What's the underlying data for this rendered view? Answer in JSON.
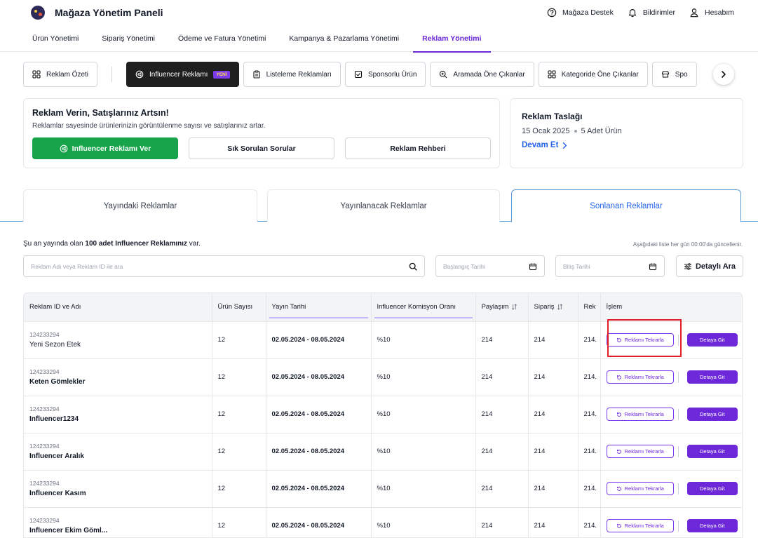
{
  "header": {
    "title": "Mağaza Yönetim Paneli",
    "actions": [
      {
        "label": "Mağaza Destek",
        "icon": "help-circle-icon"
      },
      {
        "label": "Bildirimler",
        "icon": "bell-icon"
      },
      {
        "label": "Hesabım",
        "icon": "user-icon"
      }
    ]
  },
  "main_nav": [
    {
      "label": "Ürün Yönetimi",
      "active": false
    },
    {
      "label": "Sipariş Yönetimi",
      "active": false
    },
    {
      "label": "Ödeme ve Fatura Yönetimi",
      "active": false
    },
    {
      "label": "Kampanya & Pazarlama Yönetimi",
      "active": false
    },
    {
      "label": "Reklam Yönetimi",
      "active": true
    }
  ],
  "sub_nav": {
    "summary": "Reklam Özeti",
    "items": [
      {
        "label": "Influencer Reklamı",
        "badge": "YENİ",
        "active": true
      },
      {
        "label": "Listeleme Reklamları"
      },
      {
        "label": "Sponsorlu Ürün"
      },
      {
        "label": "Aramada Öne Çıkanlar"
      },
      {
        "label": "Kategoride Öne Çıkanlar"
      },
      {
        "label": "Spo"
      }
    ]
  },
  "promo": {
    "title": "Reklam Verin, Satışlarınız Artsın!",
    "description": "Reklamlar sayesinde ürünlerinizin görüntülenme sayısı ve satışlarınız artar.",
    "primary_button": "Influencer Reklamı Ver",
    "faq_button": "Sık Sorulan Sorular",
    "guide_button": "Reklam Rehberi"
  },
  "draft": {
    "title": "Reklam Taslağı",
    "date": "15 Ocak 2025",
    "count": "5 Adet Ürün",
    "continue": "Devam Et"
  },
  "status_tabs": [
    {
      "label": "Yayındaki Reklamlar",
      "active": false
    },
    {
      "label": "Yayınlanacak Reklamlar",
      "active": false
    },
    {
      "label": "Sonlanan Reklamlar",
      "active": true
    }
  ],
  "info": {
    "prefix": "Şu an yayında olan ",
    "count": "100 adet Influencer Reklamınız",
    "suffix": " var.",
    "update_note": "Aşağıdaki liste her gün 00:00'da güncellenir."
  },
  "filters": {
    "search_placeholder": "Reklam Adı veya Reklam ID ile ara",
    "start_placeholder": "Başlangıç Tarihi",
    "end_placeholder": "Bitiş Tarihi",
    "advanced": "Detaylı Ara"
  },
  "table": {
    "headers": {
      "id": "Reklam ID ve Adı",
      "products": "Ürün Sayısı",
      "dates": "Yayın Tarihi",
      "commission": "Influencer Komisyon Oranı",
      "shares": "Paylaşım",
      "orders": "Sipariş",
      "rek": "Rek",
      "action": "İşlem"
    },
    "repeat_label": "Reklamı Tekrarla",
    "detail_label": "Detaya Git",
    "rows": [
      {
        "id": "124233294",
        "name": "Yeni Sezon Etek",
        "products": "12",
        "dates": "02.05.2024 - 08.05.2024",
        "commission": "%10",
        "shares": "214",
        "orders": "214",
        "rek": "214.",
        "bold": false
      },
      {
        "id": "124233294",
        "name": "Keten Gömlekler",
        "products": "12",
        "dates": "02.05.2024 - 08.05.2024",
        "commission": "%10",
        "shares": "214",
        "orders": "214",
        "rek": "214.",
        "bold": true
      },
      {
        "id": "124233294",
        "name": "Influencer1234",
        "products": "12",
        "dates": "02.05.2024 - 08.05.2024",
        "commission": "%10",
        "shares": "214",
        "orders": "214",
        "rek": "214.",
        "bold": true
      },
      {
        "id": "124233294",
        "name": "Influencer Aralık",
        "products": "12",
        "dates": "02.05.2024 - 08.05.2024",
        "commission": "%10",
        "shares": "214",
        "orders": "214",
        "rek": "214.",
        "bold": true
      },
      {
        "id": "124233294",
        "name": "Influencer Kasım",
        "products": "12",
        "dates": "02.05.2024 - 08.05.2024",
        "commission": "%10",
        "shares": "214",
        "orders": "214",
        "rek": "214.",
        "bold": true
      },
      {
        "id": "124233294",
        "name": "Influencer Ekim Göml...",
        "products": "12",
        "dates": "02.05.2024 - 08.05.2024",
        "commission": "%10",
        "shares": "214",
        "orders": "214",
        "rek": "214.",
        "bold": true
      }
    ]
  },
  "colors": {
    "accent": "#6d28d9",
    "primary_green": "#16a34a",
    "link_blue": "#2563eb",
    "highlight_red": "#e11d2a"
  }
}
